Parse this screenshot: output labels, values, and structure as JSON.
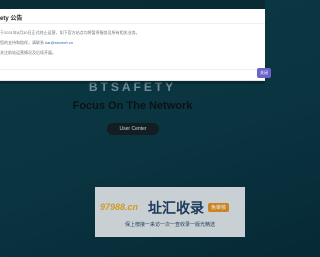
{
  "page": {
    "brand": "BTSAFETY",
    "headline": "Focus On The Network",
    "user_center_label": "User Center"
  },
  "announcement": {
    "title": "fety 公告",
    "line1": "于2021年8月30日正式终止运营，如下官方站点均将暂停服务及所有相关业务。",
    "line2_prefix": "您的支持和陪伴，请联系 ",
    "email": "kar@secmet.cn",
    "line3": "关注前站运营情况及后续开展。",
    "close_label": "关闭"
  },
  "ad": {
    "domain": "97988.cn",
    "title": "址汇收录",
    "badge": "免审核",
    "slogan": "保上榜接一来访一次一查收录一版光精选"
  }
}
